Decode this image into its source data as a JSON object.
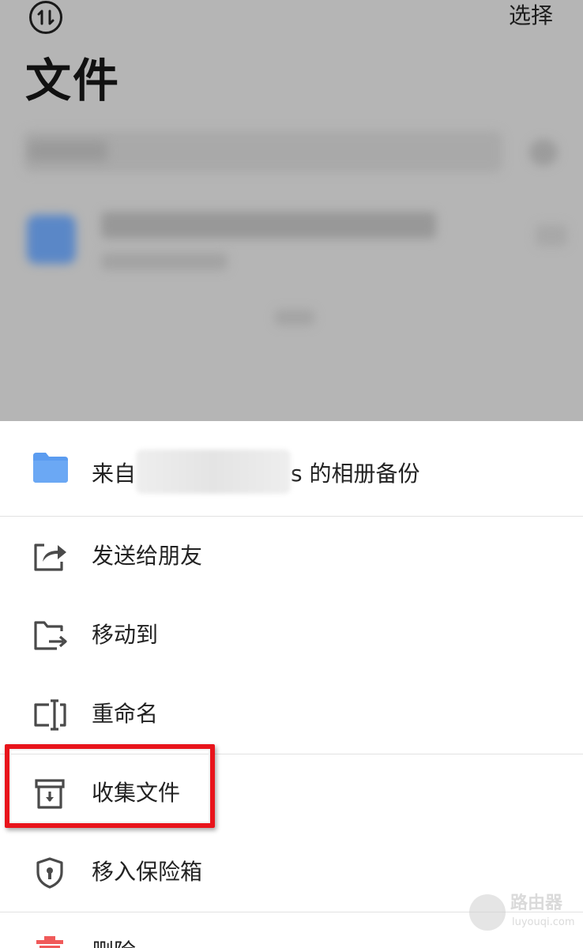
{
  "header": {
    "title": "文件",
    "select_label": "选择",
    "sort_icon": "sort-toggle-icon"
  },
  "sheet": {
    "file_title_prefix": "来自",
    "file_title_suffix": "s 的相册备份",
    "file_icon": "folder-icon",
    "folder_color": "#5B9CF0",
    "actions": [
      {
        "label": "发送给朋友",
        "icon": "share-icon"
      },
      {
        "label": "移动到",
        "icon": "move-folder-icon"
      },
      {
        "label": "重命名",
        "icon": "rename-icon"
      },
      {
        "label": "收集文件",
        "icon": "collect-file-icon",
        "highlighted": true
      },
      {
        "label": "移入保险箱",
        "icon": "vault-shield-icon"
      },
      {
        "label": "删除",
        "icon": "trash-icon"
      }
    ]
  },
  "watermark": {
    "name": "路由器",
    "domain": "luyouqi.com"
  },
  "colors": {
    "highlight": "#E8141B",
    "delete": "#F05A5A",
    "icon_gray": "#4A4A4A"
  }
}
